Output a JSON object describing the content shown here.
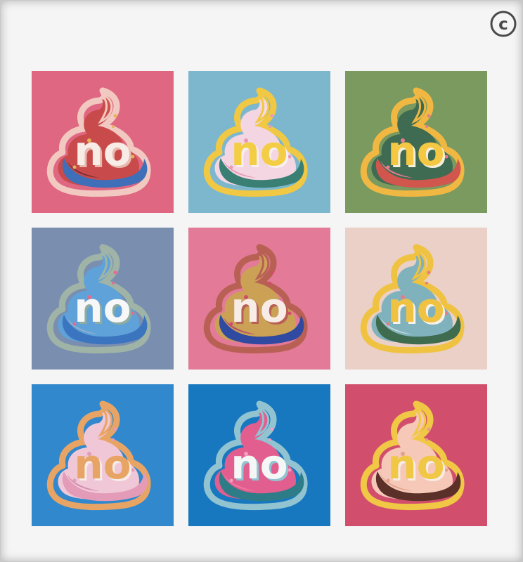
{
  "copyright": {
    "icon": "copyright-icon",
    "glyph": "©",
    "color": "#4a4a4a"
  },
  "tiles": [
    {
      "word": "no",
      "bg": "#e06781",
      "outline": "#f2c9c0",
      "body": "#c94a4a",
      "shadow1": "#3f6fb8",
      "shadow2": "#7a2f3a",
      "swirl": "#d0534b",
      "text": "#f7ece6",
      "textShadow": "#e7b9ad",
      "dots": "#e3b35a"
    },
    {
      "word": "no",
      "bg": "#7db7ce",
      "outline": "#f0c843",
      "body": "#f3d6e2",
      "shadow1": "#3a7f73",
      "shadow2": "#e79ab6",
      "swirl": "#f7d9e3",
      "text": "#f3ce45",
      "textShadow": "#f7eeef",
      "dots": "#e79ab6"
    },
    {
      "word": "no",
      "bg": "#7a9a60",
      "outline": "#f0b842",
      "body": "#3f6b52",
      "shadow1": "#d0564e",
      "shadow2": "#e77d8f",
      "swirl": "#3f6b52",
      "text": "#f4c842",
      "textShadow": "#f4efdc",
      "dots": "#e77d8f"
    },
    {
      "word": "no",
      "bg": "#7a8fb0",
      "outline": "#9fb4a6",
      "body": "#5fa2d9",
      "shadow1": "#3b74bf",
      "shadow2": "#8fb0cc",
      "swirl": "#5fa2d9",
      "text": "#f6f7f6",
      "textShadow": "#8eaca0",
      "dots": "#e66a8c"
    },
    {
      "word": "no",
      "bg": "#e37a97",
      "outline": "#b96055",
      "body": "#caa155",
      "shadow1": "#2f4aa0",
      "shadow2": "#b34a6a",
      "swirl": "#d0a25a",
      "text": "#f7ece6",
      "textShadow": "#b96055",
      "dots": "#d24b6a"
    },
    {
      "word": "no",
      "bg": "#ead0c7",
      "outline": "#f0c241",
      "body": "#7fb2bd",
      "shadow1": "#3f6b4e",
      "shadow2": "#c0d6d5",
      "swirl": "#7fb2bd",
      "text": "#f0c241",
      "textShadow": "#f6f1ea",
      "dots": "#e57d88"
    },
    {
      "word": "no",
      "bg": "#3188cc",
      "outline": "#e8a465",
      "body": "#f0c7d7",
      "shadow1": "#e39bb7",
      "shadow2": "#d38cab",
      "swirl": "#f0c7d7",
      "text": "#e8a465",
      "textShadow": "#f4ece8",
      "dots": "#e39bb7"
    },
    {
      "word": "no",
      "bg": "#1778bf",
      "outline": "#92c3d1",
      "body": "#e25e8f",
      "shadow1": "#2e7c88",
      "shadow2": "#f07aa0",
      "swirl": "#e25e8f",
      "text": "#f5f6f6",
      "textShadow": "#92c3d1",
      "dots": "#f29fbf"
    },
    {
      "word": "no",
      "bg": "#d14f6c",
      "outline": "#f1c746",
      "body": "#f5c8b8",
      "shadow1": "#5b3028",
      "shadow2": "#e5a48d",
      "swirl": "#f5c8b8",
      "text": "#f1c746",
      "textShadow": "#f7ece4",
      "dots": "#e2a08c"
    }
  ]
}
